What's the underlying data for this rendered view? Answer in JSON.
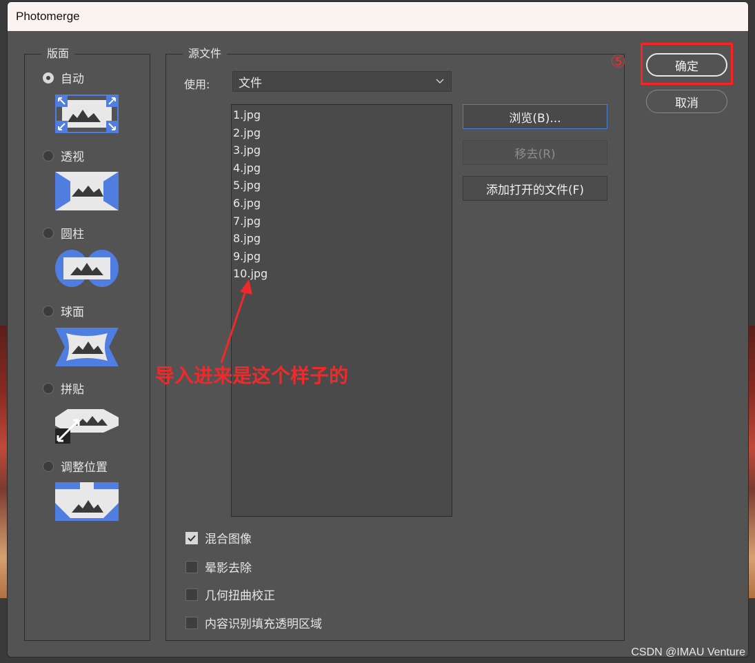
{
  "window": {
    "title": "Photomerge"
  },
  "layout_group": {
    "legend": "版面",
    "options": [
      {
        "label": "自动",
        "checked": true
      },
      {
        "label": "透视",
        "checked": false
      },
      {
        "label": "圆柱",
        "checked": false
      },
      {
        "label": "球面",
        "checked": false
      },
      {
        "label": "拼贴",
        "checked": false
      },
      {
        "label": "调整位置",
        "checked": false
      }
    ]
  },
  "source_group": {
    "legend": "源文件",
    "use_label": "使用:",
    "use_value": "文件",
    "files": [
      "1.jpg",
      "2.jpg",
      "3.jpg",
      "4.jpg",
      "5.jpg",
      "6.jpg",
      "7.jpg",
      "8.jpg",
      "9.jpg",
      "10.jpg"
    ],
    "browse_button": "浏览(B)...",
    "remove_button": "移去(R)",
    "add_open_button": "添加打开的文件(F)"
  },
  "options": [
    {
      "label": "混合图像",
      "checked": true
    },
    {
      "label": "晕影去除",
      "checked": false
    },
    {
      "label": "几何扭曲校正",
      "checked": false
    },
    {
      "label": "内容识别填充透明区域",
      "checked": false
    }
  ],
  "actions": {
    "ok": "确定",
    "cancel": "取消"
  },
  "annotations": {
    "step_number": "⑤",
    "note": "导入进来是这个样子的"
  },
  "watermark": "CSDN @IMAU Venture",
  "colors": {
    "accent_blue": "#4a7fd6",
    "annotation_red": "#ee2a2a",
    "thumb_blue": "#4f7ee0"
  }
}
